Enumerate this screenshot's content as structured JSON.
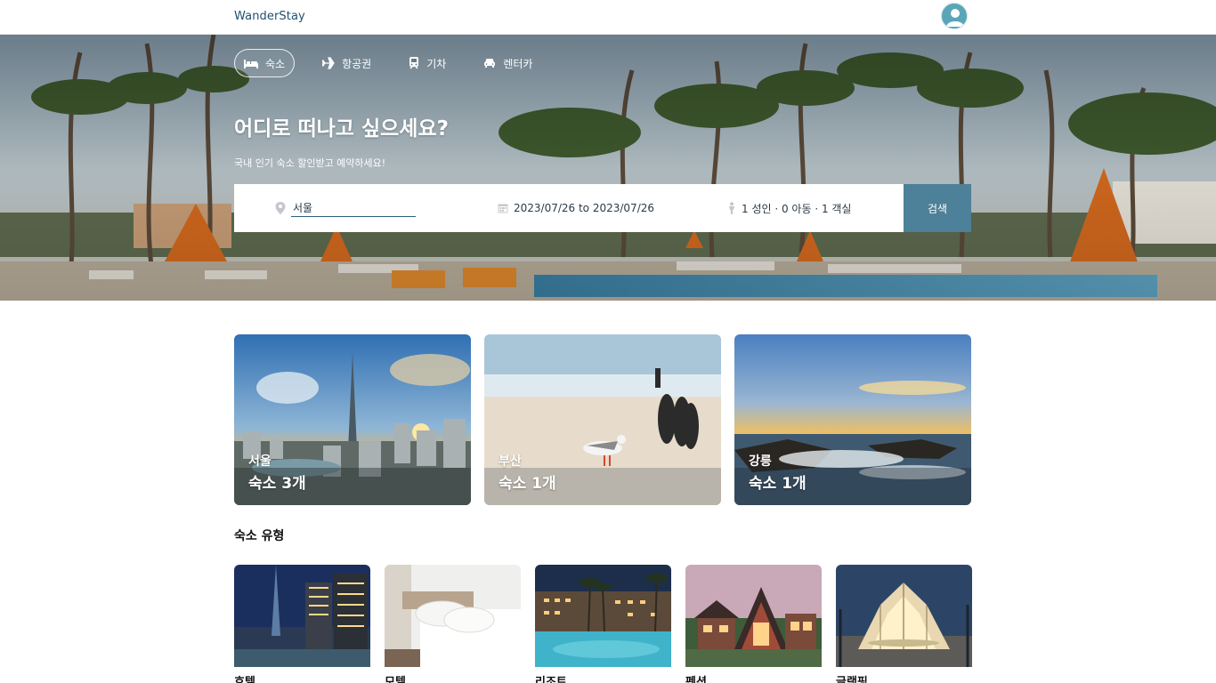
{
  "header": {
    "brand": "WanderStay",
    "avatar_icon": "user-icon"
  },
  "hero": {
    "tabs": [
      {
        "label": "숙소",
        "icon": "bed-icon",
        "active": true
      },
      {
        "label": "항공권",
        "icon": "airplane-icon",
        "active": false
      },
      {
        "label": "기차",
        "icon": "train-icon",
        "active": false
      },
      {
        "label": "렌터카",
        "icon": "car-icon",
        "active": false
      }
    ],
    "title": "어디로 떠나고 싶으세요?",
    "subtitle": "국내 인기 숙소 할인받고 예약하세요!"
  },
  "search": {
    "location_value": "서울",
    "dates": "2023/07/26 to 2023/07/26",
    "guests": "1 성인 · 0 아동 · 1 객실",
    "button": "검색"
  },
  "cities": [
    {
      "name": "서울",
      "count": "숙소 3개"
    },
    {
      "name": "부산",
      "count": "숙소 1개"
    },
    {
      "name": "강릉",
      "count": "숙소 1개"
    }
  ],
  "types_section": {
    "title": "숙소 유형",
    "items": [
      {
        "label": "호텔"
      },
      {
        "label": "모텔"
      },
      {
        "label": "리조트"
      },
      {
        "label": "펜션"
      },
      {
        "label": "글램핑"
      }
    ]
  },
  "colors": {
    "brand": "#1f4f6e",
    "search_button": "#4d8099",
    "avatar": "#5aa6b8"
  }
}
